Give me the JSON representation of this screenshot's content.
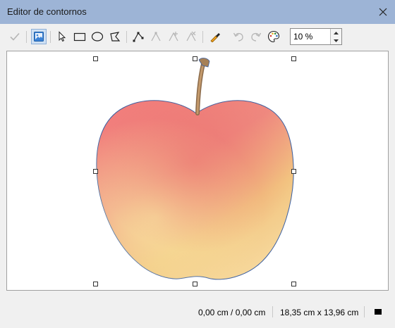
{
  "window": {
    "title": "Editor de contornos",
    "titlebar_color": "#9db4d6"
  },
  "toolbar": {
    "items": [
      {
        "icon": "check-icon",
        "label": "Aplicar",
        "enabled": false
      },
      {
        "icon": "image-icon",
        "label": "Área de trabajo",
        "enabled": true,
        "active": true
      },
      {
        "icon": "pointer-icon",
        "label": "Seleccionar",
        "enabled": true
      },
      {
        "icon": "rectangle-icon",
        "label": "Rectángulo",
        "enabled": true
      },
      {
        "icon": "ellipse-icon",
        "label": "Elipse",
        "enabled": true
      },
      {
        "icon": "polygon-icon",
        "label": "Polígono",
        "enabled": true
      },
      {
        "icon": "edit-points-icon",
        "label": "Puntos",
        "enabled": true
      },
      {
        "icon": "move-points-icon",
        "label": "Mover puntos",
        "enabled": false
      },
      {
        "icon": "insert-points-icon",
        "label": "Insertar puntos",
        "enabled": false
      },
      {
        "icon": "delete-points-icon",
        "label": "Eliminar puntos",
        "enabled": false
      },
      {
        "icon": "auto-contour-icon",
        "label": "Contorno automático",
        "enabled": true
      },
      {
        "icon": "undo-icon",
        "label": "Deshacer",
        "enabled": false
      },
      {
        "icon": "redo-icon",
        "label": "Rehacer",
        "enabled": false
      },
      {
        "icon": "color-palette-icon",
        "label": "Pipeta",
        "enabled": true
      }
    ],
    "zoom_value": "10 %"
  },
  "canvas": {
    "image_subject": "apple-icon"
  },
  "statusbar": {
    "position": "0,00 cm / 0,00 cm",
    "size": "18,35 cm x 13,96 cm"
  }
}
